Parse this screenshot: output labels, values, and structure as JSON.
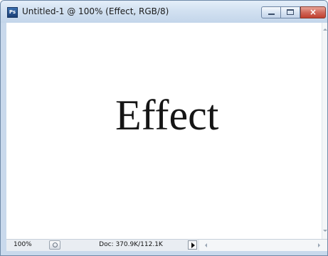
{
  "window": {
    "title": "Untitled-1 @ 100% (Effect, RGB/8)",
    "app_icon_label": "Ps",
    "close_glyph": "×",
    "icons": {
      "app": "photoshop-icon",
      "minimize": "minimize-icon",
      "maximize": "maximize-icon",
      "close": "close-icon"
    }
  },
  "canvas": {
    "text": "Effect"
  },
  "status_bar": {
    "zoom": "100%",
    "doc_info": "Doc: 370.9K/112.1K"
  },
  "colors": {
    "title_bar": "#d2e1f1",
    "close_button": "#c0402f",
    "canvas_background": "#ffffff",
    "text": "#151515"
  }
}
